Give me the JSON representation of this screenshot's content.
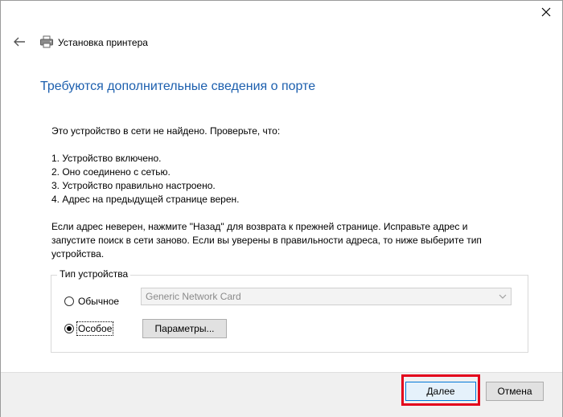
{
  "window": {
    "title": "Установка принтера"
  },
  "heading": "Требуются дополнительные сведения о порте",
  "intro": "Это устройство в сети не найдено. Проверьте, что:",
  "checklist": [
    "1.  Устройство включено.",
    "2.  Оно соединено с сетью.",
    "3.  Устройство правильно настроено.",
    "4.  Адрес на предыдущей странице верен."
  ],
  "advice": [
    "Если адрес неверен, нажмите \"Назад\" для возврата к прежней странице.  Исправьте адрес и",
    "запустите поиск в сети заново.  Если вы уверены в правильности адреса, то ниже выберите тип",
    "устройства."
  ],
  "device_type": {
    "legend": "Тип устройства",
    "option_standard": {
      "label": "Обычное",
      "selected": false
    },
    "option_custom": {
      "label": "Особое",
      "selected": true
    },
    "standard_select_value": "Generic Network Card",
    "params_button": "Параметры..."
  },
  "footer": {
    "next_button": "Далее",
    "cancel_button": "Отмена"
  },
  "colors": {
    "heading": "#1c5fae",
    "highlight": "#e3001b",
    "accent": "#0078d7"
  },
  "icons": {
    "close": "close-icon",
    "back": "back-arrow-icon",
    "printer": "printer-icon",
    "dropdown": "chevron-down-icon"
  }
}
